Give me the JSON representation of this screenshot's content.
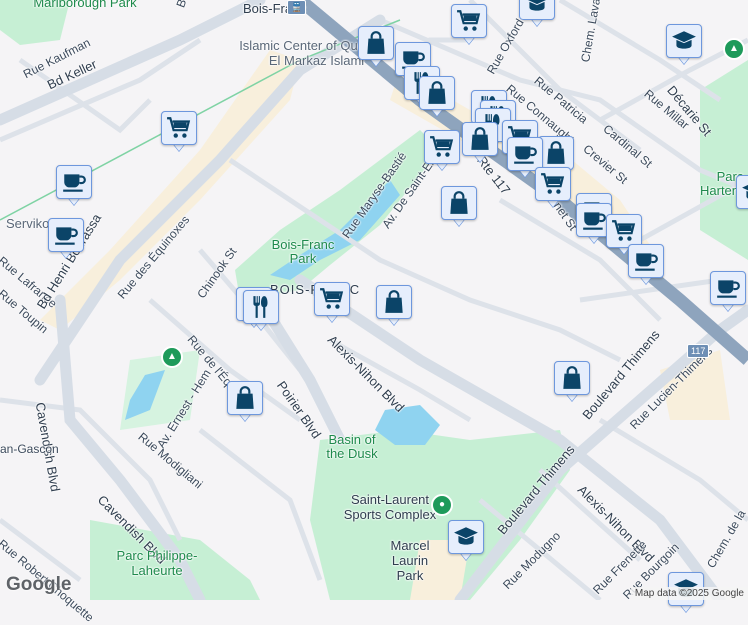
{
  "map": {
    "streets": {
      "bd_keller": "Bd Keller",
      "rue_kaufman": "Rue Kaufman",
      "bd_henri_bourassa": "Bd Henri Bourassa",
      "rue_lafrance": "Rue Lafrance",
      "rue_toupin": "Rue Toupin",
      "rue_des_equinoxes": "Rue des Équinoxes",
      "chinook_st": "Chinook St",
      "cavendish_blvd_1": "Cavendish Blvd",
      "cavendish_blvd_2": "Cavendish Blvd",
      "rue_de_lequateur": "Rue de l'Équateur",
      "poirier_blvd": "Poirier Blvd",
      "av_ernest_hemingway": "Av. Ernest - Hem",
      "rue_modigliani": "Rue Modigliani",
      "rue_robert_choquette": "Rue Robert Choquette",
      "jean_gascon": "an-Gascon",
      "alexis_nihon_blvd_1": "Alexis-Nihon Blvd",
      "alexis_nihon_blvd_2": "Alexis-Nihon Blvd",
      "rue_maryse_bastie": "Rue Maryse-Bastié",
      "av_de_saint_exupery": "Av. De Saint-Exupéry",
      "rte_117": "Rte 117",
      "rue_oxford": "Rue Oxford",
      "rue_connaught": "Rue Connaught",
      "rue_patricia": "Rue Patricia",
      "chem_laval": "Chem. Laval",
      "rue_millar": "Rue Millar",
      "cardinal_st": "Cardinal St",
      "crevier_st": "Crevier St",
      "decarie_st": "Décarie St",
      "grenet_st": "Grenet St",
      "boulevard_thimens_1": "Boulevard Thimens",
      "boulevard_thimens_2": "Boulevard Thimens",
      "rue_lucien_thimens": "Rue Lucien-Thimens",
      "rue_modugno": "Rue Modugno",
      "rue_frenette": "Rue Frenette",
      "rue_bourgoin": "Rue Bourgoin",
      "chem_de_la": "Chem. de la",
      "bd_top": "Bo"
    },
    "places": {
      "marlborough_park": "Marlborough Park",
      "bois_franc_station": "Bois-Franc",
      "islamic_center": "Islamic Center of Québec - El Markaz Islami",
      "servikon": "Servikon",
      "bois_franc_park": "Bois-Franc Park",
      "bois_franc_area": "BOIS-FRANC",
      "basin_of_the_dusk": "Basin of the Dusk",
      "saint_laurent_sports_complex": "Saint-Laurent Sports Complex",
      "marcel_laurin_park": "Marcel Laurin Park",
      "parc_philippe_laheurte": "Parc Philippe-Laheurte",
      "parc_hartenstein": "Parc Hartenstein"
    },
    "route_shield": "117",
    "markers": [
      "school",
      "cart",
      "bag",
      "cup",
      "restaurant",
      "bag",
      "restaurant",
      "restaurant",
      "restaurant",
      "cart",
      "cart",
      "bag",
      "bag",
      "cup",
      "cart",
      "cup",
      "cup",
      "cart",
      "cup",
      "bag",
      "cart",
      "cup",
      "cup",
      "restaurant",
      "restaurant",
      "cart",
      "bag",
      "bag",
      "bag",
      "school",
      "school",
      "cup",
      "school",
      "school"
    ],
    "colors": {
      "marker_icon": "#0b4468",
      "marker_bg": "#e6eefc",
      "highway": "#8ea4bd",
      "park": "#c6efd4",
      "water": "#8fd3f0",
      "commercial": "#f8efdc"
    }
  },
  "footer": {
    "logo": "Google",
    "attribution": "Map data ©2025 Google"
  }
}
